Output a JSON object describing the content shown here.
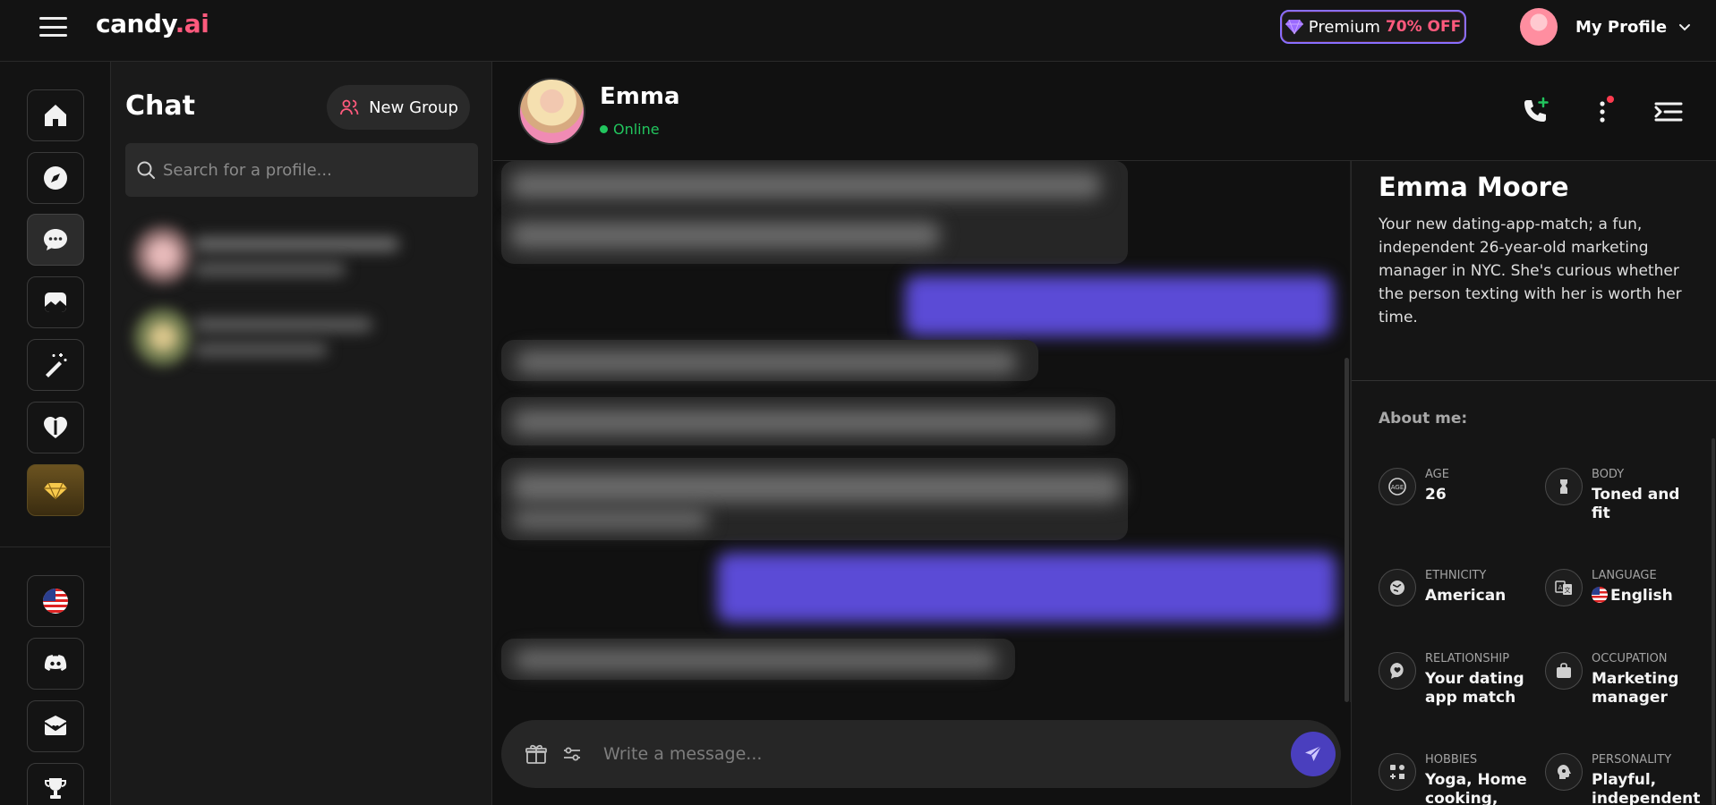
{
  "header": {
    "logo_main": "candy",
    "logo_suffix": ".ai",
    "premium_label": "Premium",
    "premium_discount": "70% OFF",
    "profile_label": "My Profile"
  },
  "rail": {
    "items": [
      "home-icon",
      "explore-icon",
      "chat-icon",
      "gallery-icon",
      "generate-icon",
      "companion-icon",
      "premium-gem-icon"
    ],
    "bottom_items": [
      "us-flag-icon",
      "discord-icon",
      "affiliate-icon",
      "trophy-icon"
    ]
  },
  "chatlist": {
    "title": "Chat",
    "new_group_label": "New Group",
    "search_placeholder": "Search for a profile..."
  },
  "chat": {
    "name": "Emma",
    "status": "Online",
    "composer_placeholder": "Write a message..."
  },
  "profile": {
    "full_name": "Emma Moore",
    "description": "Your new dating-app-match; a fun, independent 26-year-old marketing manager in NYC. She's curious whether the person texting with her is worth her time.",
    "about_label": "About me:",
    "attributes": [
      {
        "label": "AGE",
        "value": "26",
        "icon": "age-icon"
      },
      {
        "label": "BODY",
        "value": "Toned and fit",
        "icon": "body-icon"
      },
      {
        "label": "ETHNICITY",
        "value": "American",
        "icon": "ethnicity-icon"
      },
      {
        "label": "LANGUAGE",
        "value": "English",
        "icon": "language-icon"
      },
      {
        "label": "RELATIONSHIP",
        "value": "Your dating app match",
        "icon": "relationship-icon"
      },
      {
        "label": "OCCUPATION",
        "value": "Marketing manager",
        "icon": "occupation-icon"
      },
      {
        "label": "HOBBIES",
        "value": "Yoga, Home cooking,",
        "icon": "hobbies-icon"
      },
      {
        "label": "PERSONALITY",
        "value": "Playful, independent",
        "icon": "personality-icon"
      }
    ]
  },
  "colors": {
    "accent_pink": "#ff5a7d",
    "accent_purple": "#5b4bd6",
    "online_green": "#22c55e",
    "background": "#111111"
  }
}
